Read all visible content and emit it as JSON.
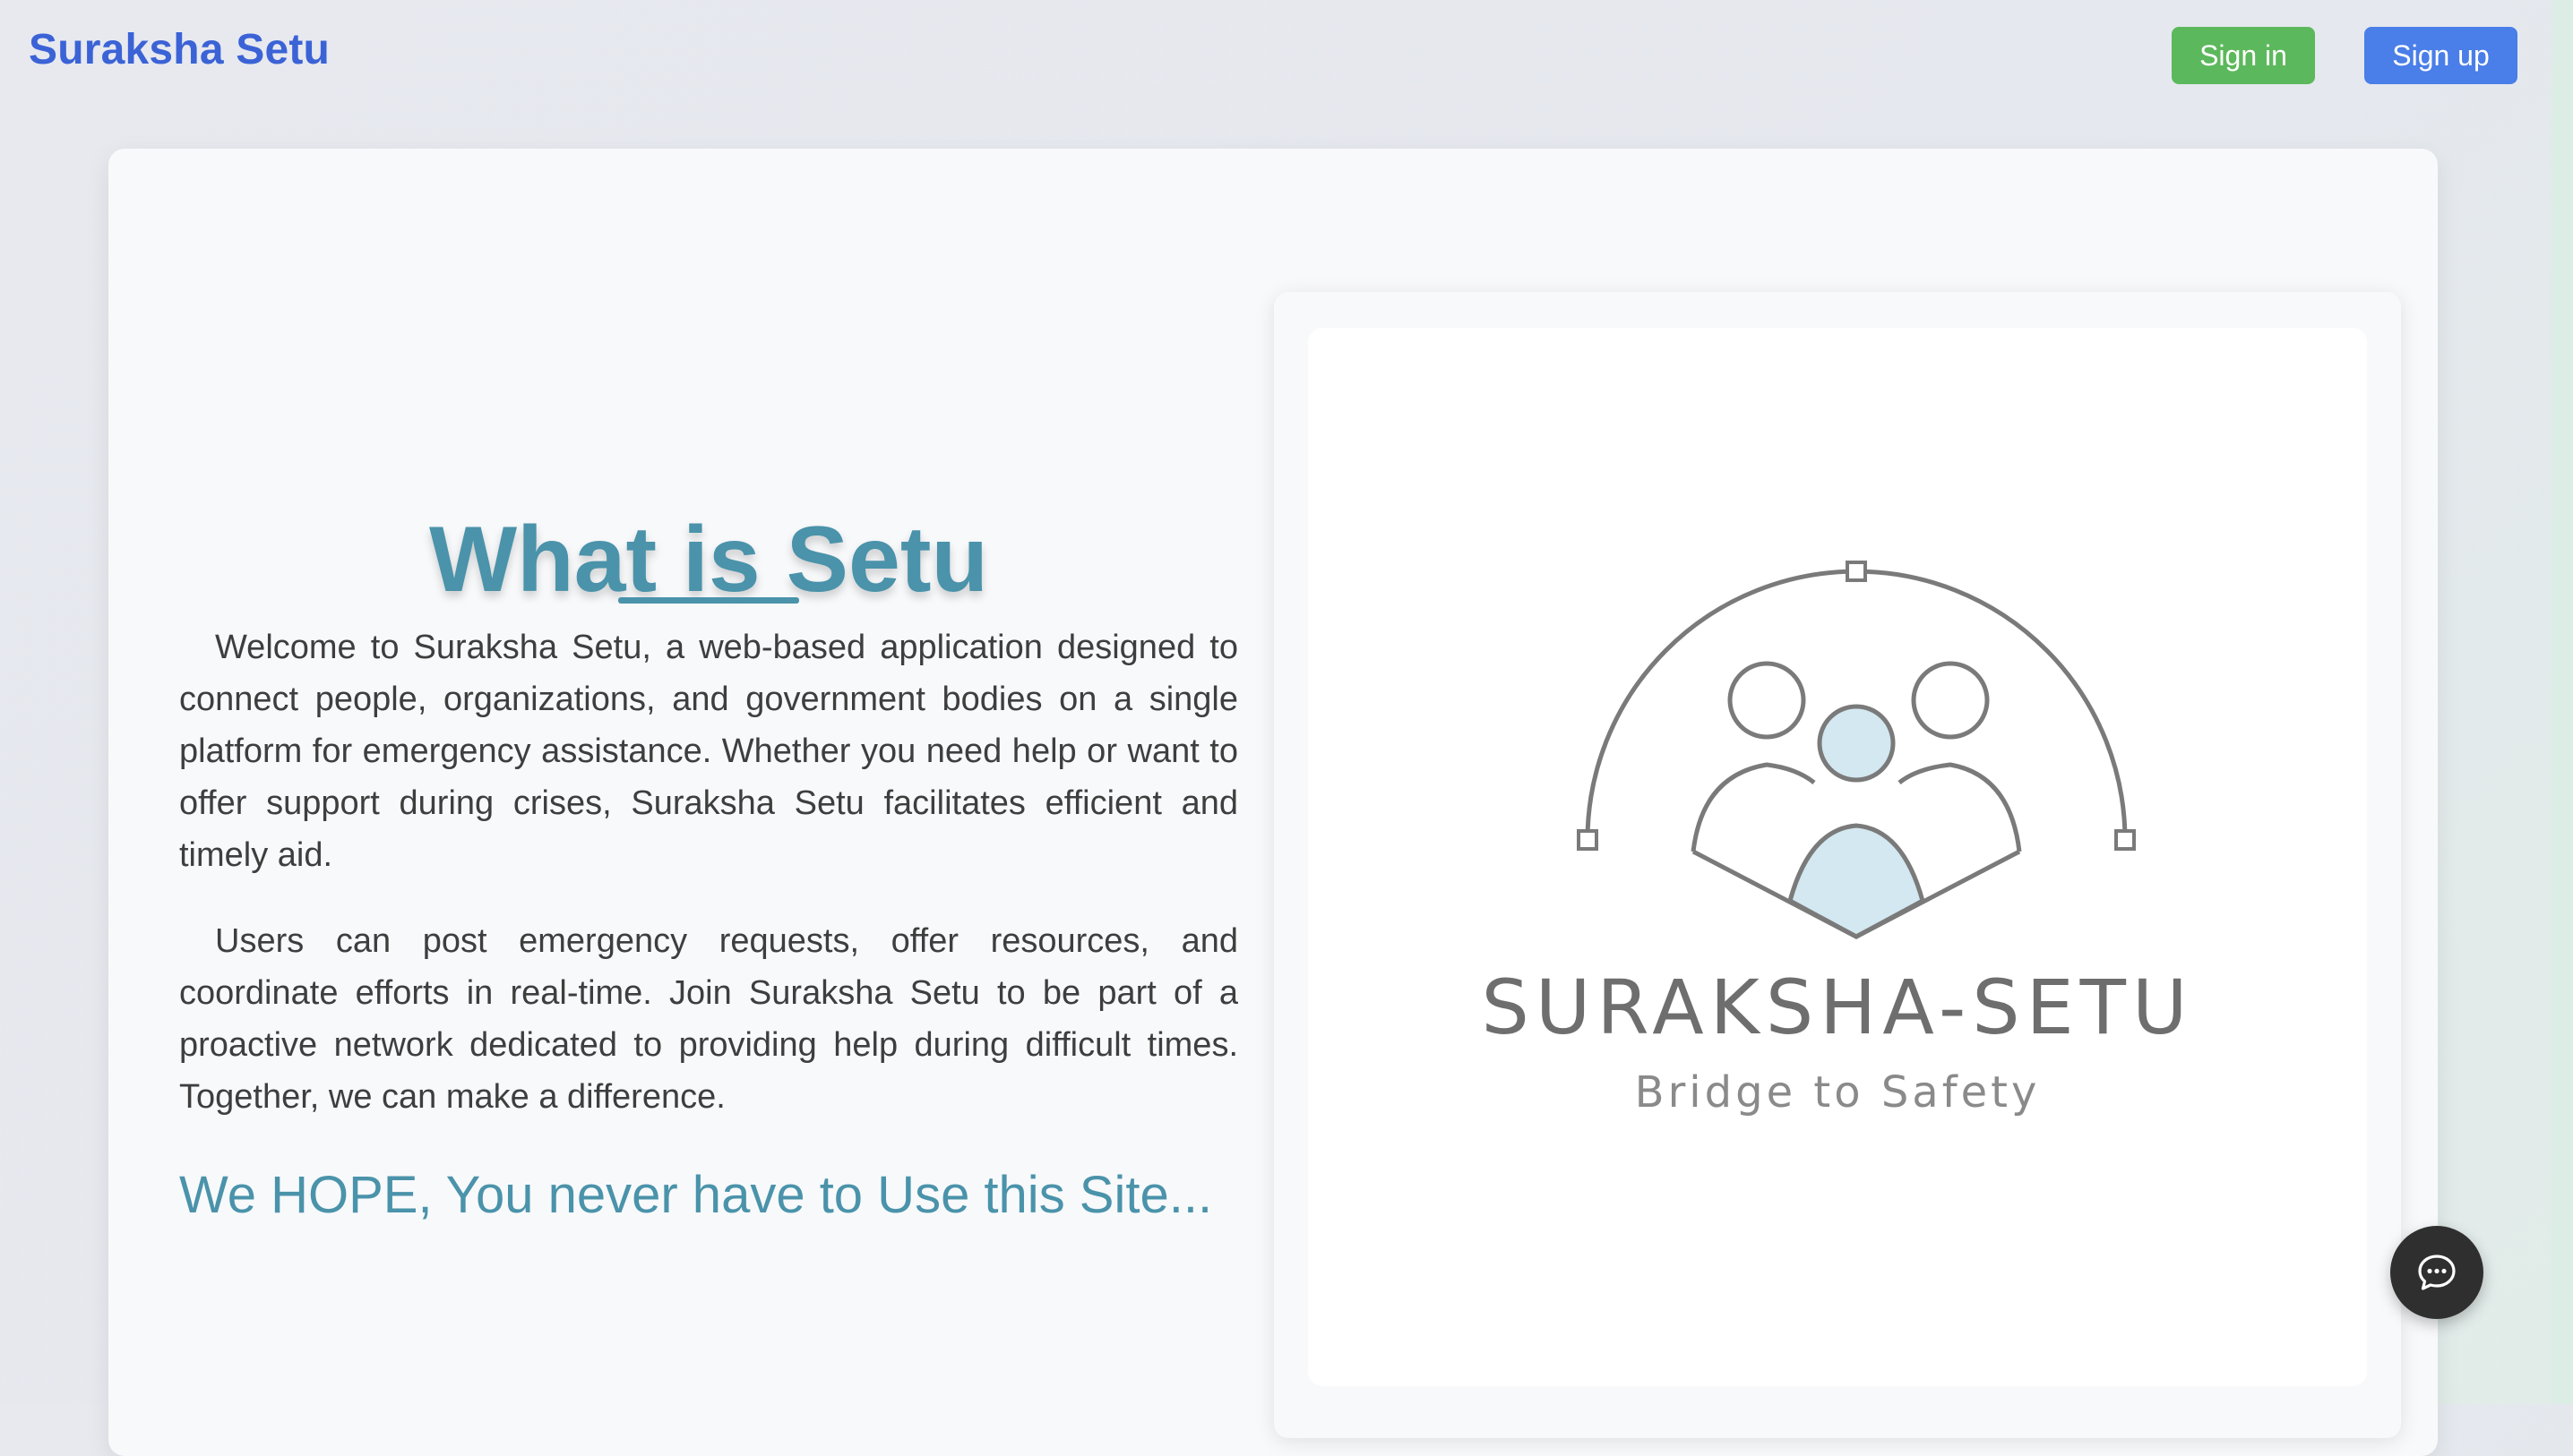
{
  "brand": {
    "name": "Suraksha Setu"
  },
  "nav": {
    "signin_label": "Sign in",
    "signup_label": "Sign up"
  },
  "about": {
    "heading": "What is Setu",
    "paragraph1": "Welcome to Suraksha Setu, a web-based application designed to connect people, organizations, and government bodies on a single platform for emergency assistance. Whether you need help or want to offer support during crises, Suraksha Setu facilitates efficient and timely aid.",
    "paragraph2": "Users can post emergency requests, offer resources, and coordinate efforts in real-time. Join Suraksha Setu to be part of a proactive network dedicated to providing help during difficult times. Together, we can make a difference.",
    "hope": "We HOPE, You never have to Use this Site..."
  },
  "logo": {
    "title": "SURAKSHA-SETU",
    "tagline": "Bridge to Safety",
    "icon": "community-shield-logo"
  },
  "chat": {
    "icon": "chat-bubble-icon"
  },
  "colors": {
    "brand": "#3b63d6",
    "signin_bg": "#5cb85c",
    "signup_bg": "#4a7ee8",
    "accent_teal": "#4a93aa",
    "logo_fill": "#d3e8f0",
    "logo_stroke": "#7a7a7a",
    "chat_bg": "#2f2f2f"
  }
}
